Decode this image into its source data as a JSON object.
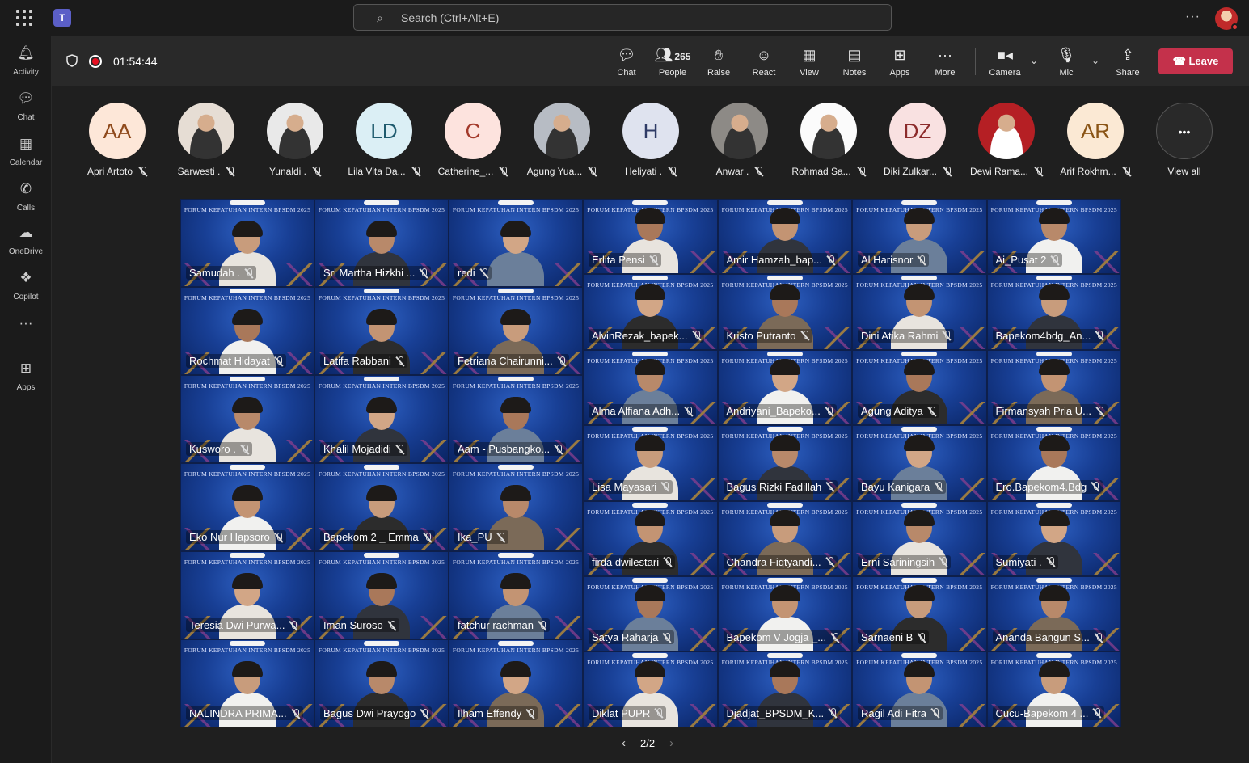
{
  "app": {
    "search_placeholder": "Search (Ctrl+Alt+E)",
    "more": "···"
  },
  "rail": [
    {
      "label": "Activity",
      "icon": "bell-icon",
      "glyph": "🔔︎"
    },
    {
      "label": "Chat",
      "icon": "chat-icon",
      "glyph": "💬︎"
    },
    {
      "label": "Calendar",
      "icon": "calendar-icon",
      "glyph": "▦"
    },
    {
      "label": "Calls",
      "icon": "phone-icon",
      "glyph": "✆"
    },
    {
      "label": "OneDrive",
      "icon": "cloud-icon",
      "glyph": "☁"
    },
    {
      "label": "Copilot",
      "icon": "copilot-icon",
      "glyph": "❖"
    },
    {
      "label": "",
      "icon": "more-apps-icon",
      "glyph": "···"
    },
    {
      "label": "Apps",
      "icon": "apps-plus-icon",
      "glyph": "⊞"
    }
  ],
  "meeting": {
    "timer": "01:54:44",
    "participant_count": "265",
    "toolbar": [
      {
        "label": "Chat",
        "icon": "chat-icon",
        "glyph": "💬︎"
      },
      {
        "label": "People",
        "icon": "people-icon",
        "glyph": "👥︎"
      },
      {
        "label": "Raise",
        "icon": "raise-hand-icon",
        "glyph": "✋︎"
      },
      {
        "label": "React",
        "icon": "smiley-icon",
        "glyph": "☺"
      },
      {
        "label": "View",
        "icon": "grid-view-icon",
        "glyph": "▦"
      },
      {
        "label": "Notes",
        "icon": "notes-icon",
        "glyph": "▤"
      },
      {
        "label": "Apps",
        "icon": "apps-plus-icon",
        "glyph": "⊞"
      },
      {
        "label": "More",
        "icon": "more-icon",
        "glyph": "···"
      }
    ],
    "camera_label": "Camera",
    "mic_label": "Mic",
    "share_label": "Share",
    "leave_label": "Leave"
  },
  "roster": [
    {
      "initials": "AA",
      "name": "Apri Artoto",
      "bg": "#fde7d8",
      "fg": "#8f4a1c",
      "photo": false
    },
    {
      "initials": "",
      "name": "Sarwesti .",
      "bg": "#e6ddd4",
      "fg": "#333",
      "photo": true
    },
    {
      "initials": "",
      "name": "Yunaldi .",
      "bg": "#e9e9e9",
      "fg": "#333",
      "photo": true
    },
    {
      "initials": "LD",
      "name": "Lila Vita Da...",
      "bg": "#dbeff5",
      "fg": "#1f5b6e",
      "photo": false
    },
    {
      "initials": "C",
      "name": "Catherine_...",
      "bg": "#fde3de",
      "fg": "#a3392a",
      "photo": false
    },
    {
      "initials": "",
      "name": "Agung Yua...",
      "bg": "#b7bcc4",
      "fg": "#333",
      "photo": true
    },
    {
      "initials": "H",
      "name": "Heliyati .",
      "bg": "#dfe3ef",
      "fg": "#2f3b66",
      "photo": false
    },
    {
      "initials": "",
      "name": "Anwar .",
      "bg": "#8d8a86",
      "fg": "#333",
      "photo": true
    },
    {
      "initials": "",
      "name": "Rohmad Sa...",
      "bg": "#fbfbfb",
      "fg": "#333",
      "photo": true
    },
    {
      "initials": "DZ",
      "name": "Diki Zulkar...",
      "bg": "#f9e1e1",
      "fg": "#8c2b2b",
      "photo": false
    },
    {
      "initials": "",
      "name": "Dewi Rama...",
      "bg": "#b51f24",
      "fg": "#fff",
      "photo": true
    },
    {
      "initials": "AR",
      "name": "Arif Rokhm...",
      "bg": "#fbe9d4",
      "fg": "#8a5415",
      "photo": false
    }
  ],
  "view_all_label": "View all",
  "banner_text": "FORUM KEPATUHAN INTERN BPSDM 2025",
  "tiles_left": [
    [
      "Samudah .",
      "Sri Martha Hizkhi ...",
      "redi"
    ],
    [
      "Rochmat Hidayat",
      "Latifa Rabbani",
      "Fetriana Chairunni..."
    ],
    [
      "Kusworo .",
      "Khalil Mojadidi",
      "Aam - Pusbangko..."
    ],
    [
      "Eko Nur Hapsoro",
      "Bapekom 2 _ Emma",
      "Ika_PU"
    ],
    [
      "Teresia Dwi Purwa...",
      "Iman Suroso",
      "fatchur rachman"
    ],
    [
      "NALINDRA PRIMA...",
      "Bagus Dwi Prayogo",
      "Ilham Effendy"
    ]
  ],
  "tiles_right": [
    [
      "Erlita Pensi",
      "Amir Hamzah_bap...",
      "Al Harisnor",
      "Ai_Pusat 2"
    ],
    [
      "AlvinRezak_bapek...",
      "Kristo Putranto",
      "Dini Atika Rahmi",
      "Bapekom4bdg_An..."
    ],
    [
      "Alma Alfiana Adh...",
      "Andriyani_Bapeko...",
      "Agung Aditya",
      "Firmansyah Pria U..."
    ],
    [
      "Lisa Mayasari",
      "Bagus Rizki Fadillah",
      "Bayu Kanigara",
      "Ero.Bapekom4.Bdg"
    ],
    [
      "firda dwilestari",
      "Chandra Fiqtyandi...",
      "Erni Sariningsih",
      "Sumiyati ."
    ],
    [
      "Satya Raharja",
      "Bapekom V Jogja _...",
      "Sarnaeni B",
      "Ananda Bangun S..."
    ],
    [
      "Diklat PUPR",
      "Djadjat_BPSDM_K...",
      "Ragil Adi Fitra",
      "Cucu-Bapekom 4 ..."
    ]
  ],
  "pager": {
    "text": "2/2"
  }
}
